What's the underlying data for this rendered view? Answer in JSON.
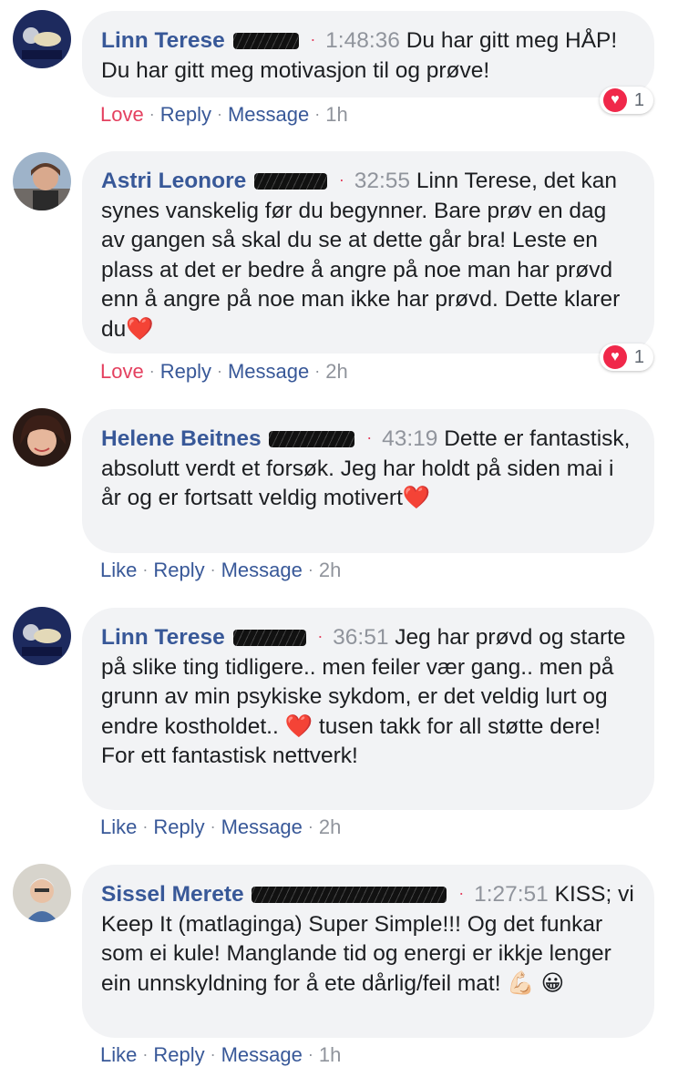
{
  "comments": [
    {
      "author": "Linn Terese",
      "timestamp": "1:48:36",
      "text": "Du har gitt meg HÅP! Du har gitt meg motivasjon til og prøve!",
      "actions": {
        "react": "Love",
        "reply": "Reply",
        "message": "Message",
        "time": "1h"
      },
      "reaction_count": "1"
    },
    {
      "author": "Astri Leonore",
      "timestamp": "32:55",
      "text": "Linn Terese, det kan synes vanskelig før du begynner. Bare prøv en dag av gangen så skal du se at dette går bra! Leste en plass at det er bedre å angre på noe man har prøvd enn å angre på noe man ikke har prøvd. Dette klarer du",
      "actions": {
        "react": "Love",
        "reply": "Reply",
        "message": "Message",
        "time": "2h"
      },
      "reaction_count": "1"
    },
    {
      "author": "Helene Beitnes",
      "timestamp": "43:19",
      "text": "Dette er fantastisk, absolutt verdt et forsøk. Jeg har holdt på siden mai i år og er fortsatt veldig motivert",
      "actions": {
        "react": "Like",
        "reply": "Reply",
        "message": "Message",
        "time": "2h"
      }
    },
    {
      "author": "Linn Terese",
      "timestamp": "36:51",
      "text_a": "Jeg har prøvd og starte på slike ting tidligere.. men feiler vær gang.. men på grunn av min psykiske sykdom, er det veldig lurt og endre kostholdet..",
      "text_b": "tusen takk for all støtte dere! For ett fantastisk nettverk!",
      "actions": {
        "react": "Like",
        "reply": "Reply",
        "message": "Message",
        "time": "2h"
      }
    },
    {
      "author": "Sissel Merete",
      "timestamp": "1:27:51",
      "text": "KISS; vi Keep It (matlaginga) Super Simple!!! Og det funkar som ei kule! Manglande tid og energi er ikkje lenger ein unnskyldning for å ete dårlig/feil mat!",
      "actions": {
        "react": "Like",
        "reply": "Reply",
        "message": "Message",
        "time": "1h"
      }
    }
  ],
  "colors": {
    "link": "#385898",
    "love": "#e4405f",
    "bubble": "#f2f3f5",
    "meta": "#90949c"
  },
  "icons": {
    "heart_emoji": "❤️",
    "muscle_emoji": "💪🏻",
    "grin_emoji": "😀"
  }
}
